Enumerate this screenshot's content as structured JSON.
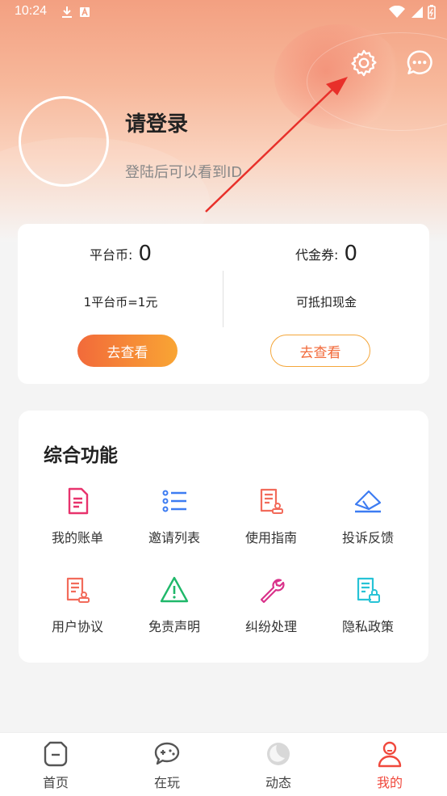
{
  "status_bar": {
    "time": "10:24"
  },
  "profile": {
    "title": "请登录",
    "subtitle": "登陆后可以看到ID"
  },
  "wallet": {
    "platform_label": "平台币:",
    "platform_value": "0",
    "platform_desc": "1平台币=1元",
    "platform_button": "去查看",
    "voucher_label": "代金券:",
    "voucher_value": "0",
    "voucher_desc": "可抵扣现金",
    "voucher_button": "去查看"
  },
  "functions": {
    "title": "综合功能",
    "items": [
      {
        "label": "我的账单",
        "icon": "bill-icon",
        "color": "#e8336d"
      },
      {
        "label": "邀请列表",
        "icon": "list-icon",
        "color": "#3d7cf2"
      },
      {
        "label": "使用指南",
        "icon": "guide-icon",
        "color": "#f26b5b"
      },
      {
        "label": "投诉反馈",
        "icon": "feedback-icon",
        "color": "#3d7cf2"
      },
      {
        "label": "用户协议",
        "icon": "agreement-icon",
        "color": "#f26b5b"
      },
      {
        "label": "免责声明",
        "icon": "warning-icon",
        "color": "#1fb86a"
      },
      {
        "label": "纠纷处理",
        "icon": "wrench-icon",
        "color": "#d9318a"
      },
      {
        "label": "隐私政策",
        "icon": "privacy-icon",
        "color": "#27c3d6"
      }
    ]
  },
  "tabbar": {
    "items": [
      {
        "label": "首页",
        "icon": "home-icon"
      },
      {
        "label": "在玩",
        "icon": "gamepad-icon"
      },
      {
        "label": "动态",
        "icon": "moon-icon"
      },
      {
        "label": "我的",
        "icon": "person-icon"
      }
    ],
    "active_color": "#f0483c"
  }
}
